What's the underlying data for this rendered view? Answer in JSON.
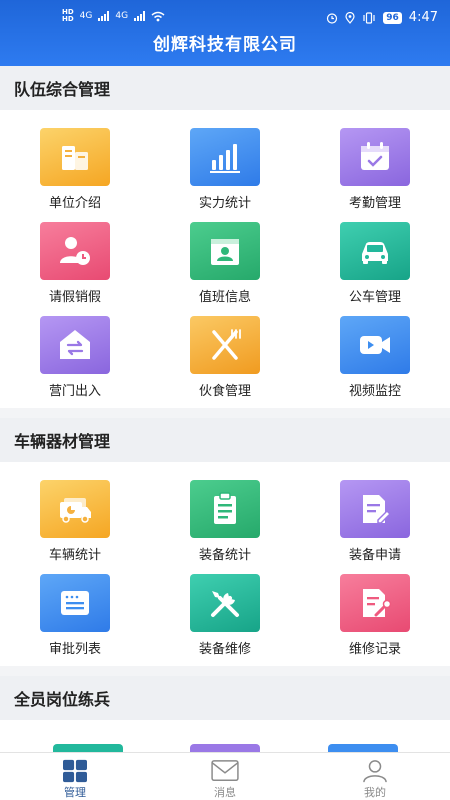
{
  "status_bar": {
    "network_left": "HD",
    "network_4g_1": "4G",
    "network_4g_2": "4G",
    "battery": "96",
    "time": "4:47"
  },
  "app": {
    "title": "创辉科技有限公司"
  },
  "sections": [
    {
      "title": "队伍综合管理",
      "items": [
        {
          "label": "单位介绍",
          "icon": "building-icon",
          "color": "#f7bb3f"
        },
        {
          "label": "实力统计",
          "icon": "bar-chart-icon",
          "color": "#3d8ef0"
        },
        {
          "label": "考勤管理",
          "icon": "calendar-check-icon",
          "color": "#9a78e6"
        },
        {
          "label": "请假销假",
          "icon": "user-clock-icon",
          "color": "#ef5a7f"
        },
        {
          "label": "值班信息",
          "icon": "duty-schedule-icon",
          "color": "#2fb87a"
        },
        {
          "label": "公车管理",
          "icon": "car-icon",
          "color": "#22b89c"
        },
        {
          "label": "营门出入",
          "icon": "gate-exchange-icon",
          "color": "#9a78e6"
        },
        {
          "label": "伙食管理",
          "icon": "utensils-icon",
          "color": "#f5b63a"
        },
        {
          "label": "视频监控",
          "icon": "video-camera-icon",
          "color": "#3d8ef0"
        }
      ]
    },
    {
      "title": "车辆器材管理",
      "items": [
        {
          "label": "车辆统计",
          "icon": "truck-icon",
          "color": "#f7bb3f"
        },
        {
          "label": "装备统计",
          "icon": "clipboard-icon",
          "color": "#2fb87a"
        },
        {
          "label": "装备申请",
          "icon": "document-edit-icon",
          "color": "#9a78e6"
        },
        {
          "label": "审批列表",
          "icon": "list-card-icon",
          "color": "#3d8ef0"
        },
        {
          "label": "装备维修",
          "icon": "tools-icon",
          "color": "#22b89c"
        },
        {
          "label": "维修记录",
          "icon": "record-wrench-icon",
          "color": "#ef5a7f"
        }
      ]
    },
    {
      "title": "全员岗位练兵",
      "peek_colors": [
        "#22b89c",
        "#9a78e6",
        "#3d8ef0"
      ]
    }
  ],
  "tabbar": [
    {
      "label": "管理",
      "icon": "grid-icon",
      "active": true
    },
    {
      "label": "消息",
      "icon": "envelope-icon",
      "active": false
    },
    {
      "label": "我的",
      "icon": "person-icon",
      "active": false
    }
  ]
}
